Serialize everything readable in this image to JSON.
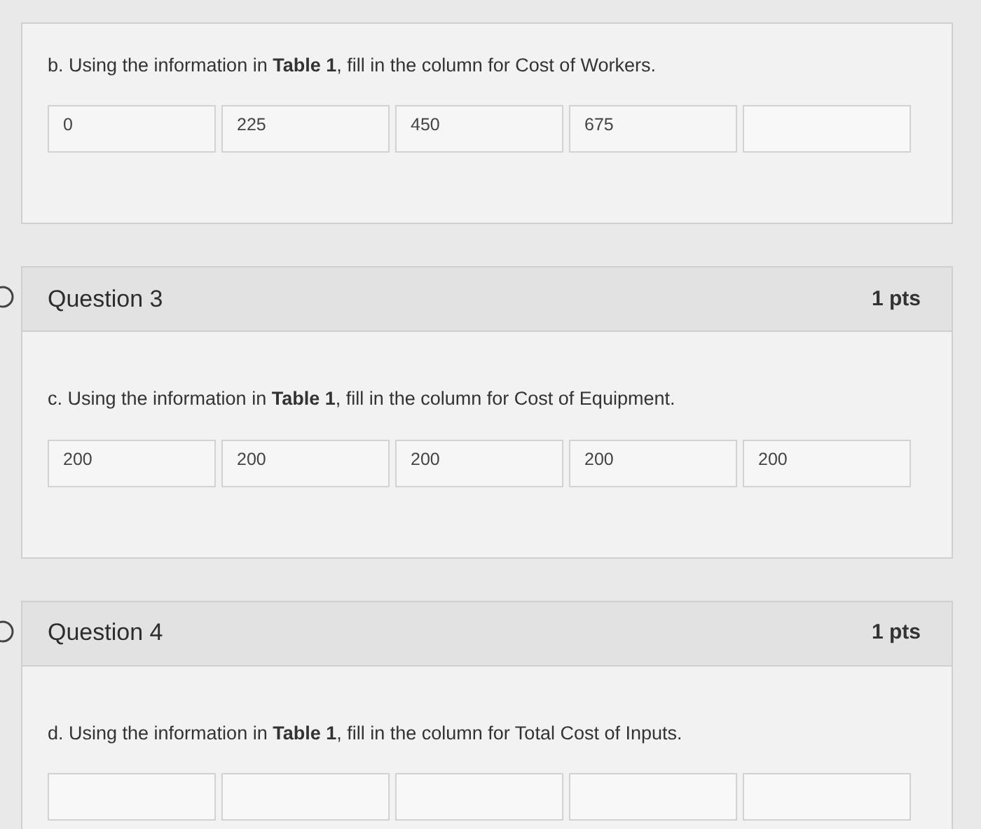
{
  "questions": [
    {
      "prompt": "b. Using the information in **Table 1**, fill in the column for Cost of Workers.",
      "fields": [
        {
          "answered": true,
          "value": "0"
        },
        {
          "answered": true,
          "value": "225"
        },
        {
          "answered": true,
          "value": "450"
        },
        {
          "answered": true,
          "value": "675"
        },
        {
          "answered": false
        }
      ]
    },
    {
      "header": {
        "title": "Question 3",
        "points": "1 pts"
      },
      "prompt": "c. Using the information in **Table 1**, fill in the column for Cost of Equipment.",
      "fields": [
        {
          "answered": true,
          "value": "200"
        },
        {
          "answered": true,
          "value": "200"
        },
        {
          "answered": true,
          "value": "200"
        },
        {
          "answered": true,
          "value": "200"
        },
        {
          "answered": true,
          "value": "200"
        }
      ]
    },
    {
      "header": {
        "title": "Question 4",
        "points": "1 pts"
      },
      "prompt": "d. Using the information in **Table 1**, fill in the column for Total Cost of Inputs.",
      "fields": [
        {
          "answered": false
        },
        {
          "answered": false
        },
        {
          "answered": false
        },
        {
          "answered": false
        },
        {
          "answered": false
        }
      ]
    }
  ]
}
